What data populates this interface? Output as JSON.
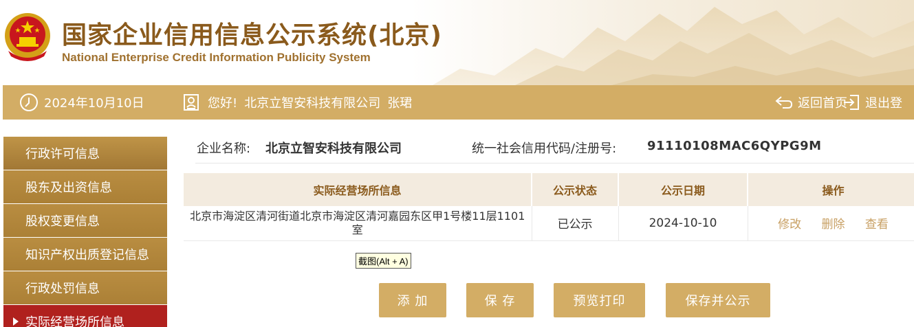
{
  "header": {
    "title": "国家企业信用信息公示系统(北京)",
    "subtitle": "National Enterprise Credit Information Publicity System"
  },
  "topbar": {
    "date": "2024年10月10日",
    "greeting": "您好!",
    "company": "北京立智安科技有限公司",
    "user": "张珺",
    "home_label": "返回首页",
    "logout_label": "退出登"
  },
  "sidebar": {
    "items": [
      {
        "label": "行政许可信息"
      },
      {
        "label": "股东及出资信息"
      },
      {
        "label": "股权变更信息"
      },
      {
        "label": "知识产权出质登记信息"
      },
      {
        "label": "行政处罚信息"
      },
      {
        "label": "实际经营场所信息"
      }
    ]
  },
  "company": {
    "name_label": "企业名称:",
    "name": "北京立智安科技有限公司",
    "code_label": "统一社会信用代码/注册号:",
    "code": "91110108MAC6QYPG9M"
  },
  "table": {
    "headers": [
      "实际经营场所信息",
      "公示状态",
      "公示日期",
      "操作"
    ],
    "rows": [
      {
        "address": "北京市海淀区清河街道北京市海淀区清河嘉园东区甲1号楼11层1101室",
        "status": "已公示",
        "date": "2024-10-10",
        "ops": [
          "修改",
          "删除",
          "查看"
        ]
      }
    ]
  },
  "tooltip": "截图(Alt + A)",
  "buttons": {
    "add": "添 加",
    "save": "保 存",
    "preview": "预览打印",
    "publish": "保存并公示"
  },
  "colors": {
    "gold": "#d3ad65",
    "title_brown": "#8a5a1c",
    "active_red": "#b0211e"
  }
}
